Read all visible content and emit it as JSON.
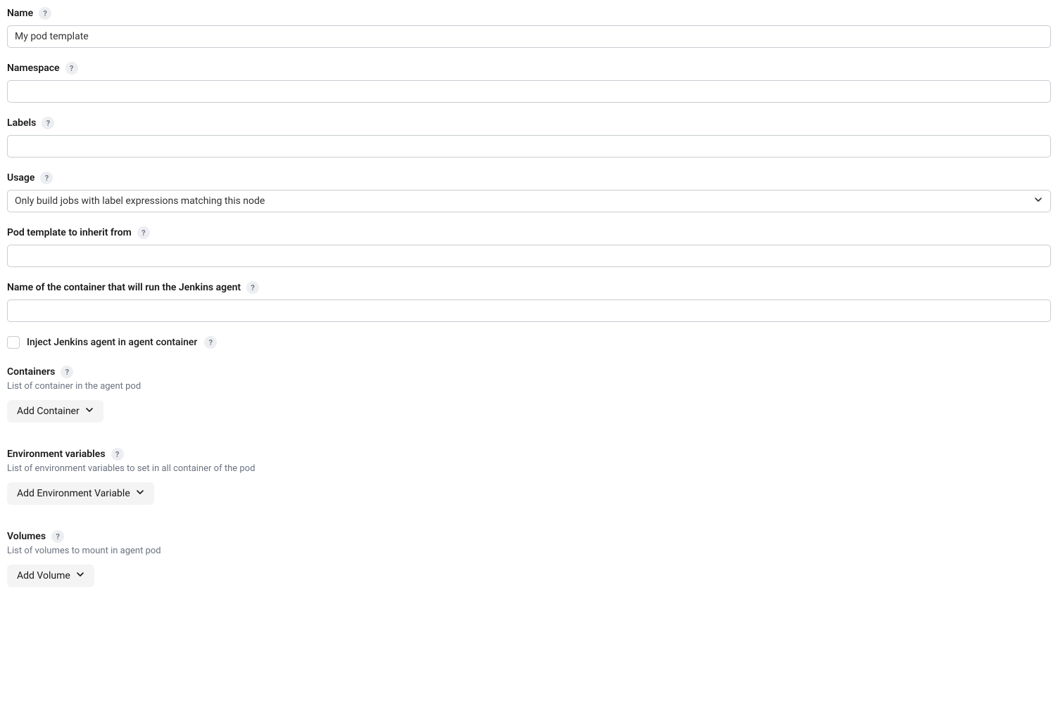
{
  "help_icon_text": "?",
  "fields": {
    "name": {
      "label": "Name",
      "value": "My pod template"
    },
    "namespace": {
      "label": "Namespace",
      "value": ""
    },
    "labels": {
      "label": "Labels",
      "value": ""
    },
    "usage": {
      "label": "Usage",
      "value": "Only build jobs with label expressions matching this node"
    },
    "inherit": {
      "label": "Pod template to inherit from",
      "value": ""
    },
    "agent_container_name": {
      "label": "Name of the container that will run the Jenkins agent",
      "value": ""
    },
    "inject_agent": {
      "label": "Inject Jenkins agent in agent container",
      "checked": false
    }
  },
  "sections": {
    "containers": {
      "title": "Containers",
      "desc": "List of container in the agent pod",
      "button_label": "Add Container"
    },
    "env_vars": {
      "title": "Environment variables",
      "desc": "List of environment variables to set in all container of the pod",
      "button_label": "Add Environment Variable"
    },
    "volumes": {
      "title": "Volumes",
      "desc": "List of volumes to mount in agent pod",
      "button_label": "Add Volume"
    }
  }
}
